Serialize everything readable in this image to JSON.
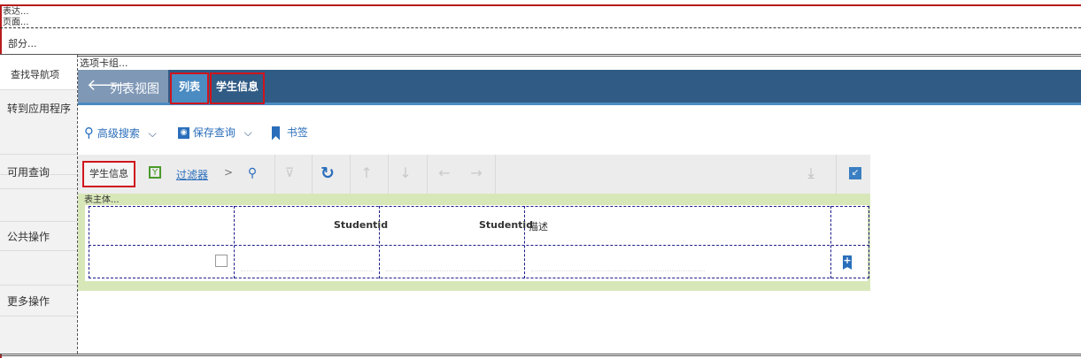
{
  "labels": {
    "expression": "表达...",
    "page": "页面...",
    "section": "部分...",
    "tab_group": "选项卡组...",
    "table_body": "表主体..."
  },
  "leftnav": {
    "items": [
      {
        "label": "查找导航项"
      },
      {
        "label": "转到应用程序"
      },
      {
        "label": "可用查询"
      },
      {
        "label": "公共操作"
      },
      {
        "label": "更多操作"
      }
    ]
  },
  "header": {
    "back_label": "列表视图",
    "tabs": [
      {
        "label": "列表"
      },
      {
        "label": "学生信息"
      }
    ]
  },
  "search": {
    "advanced_label": "高级搜索",
    "save_query_label": "保存查询",
    "bookmark_label": "书签"
  },
  "toolbar": {
    "entity_label": "学生信息",
    "filter_label": "过滤器",
    "chevron": ">"
  },
  "grid": {
    "columns": [
      "",
      "Studentid",
      "Studentid",
      "描述",
      ""
    ]
  },
  "colors": {
    "header_bg": "#305b85",
    "back_bg": "#7f98b6",
    "accent": "#4a8bc2",
    "highlight_red": "#d0141c",
    "grid_bg": "#d8e7b8"
  }
}
